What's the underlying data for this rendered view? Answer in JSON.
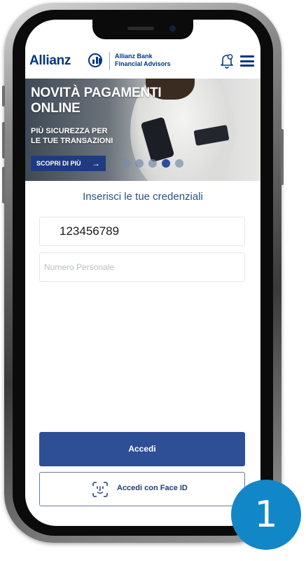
{
  "app": {
    "brand_name": "Allianz",
    "brand_subtitle_line1": "Allianz Bank",
    "brand_subtitle_line2": "Financial Advisors"
  },
  "banner": {
    "title_line1": "NOVITÀ PAGAMENTI",
    "title_line2": "ONLINE",
    "subtitle_line1": "PIÙ SICUREZZA PER",
    "subtitle_line2": "LE TUE TRANSAZIONI",
    "cta_label": "SCOPRI DI PIÙ",
    "cta_arrow": "→",
    "carousel_count": 5,
    "carousel_active_index": 3
  },
  "form": {
    "title": "Inserisci le tue credenziali",
    "username_value": "123456789",
    "personal_number_placeholder": "Numero Personale"
  },
  "actions": {
    "login_label": "Accedi",
    "face_id_label": "Accedi con Face ID"
  },
  "step": {
    "number": "1"
  },
  "colors": {
    "brand_blue": "#003781",
    "button_blue": "#2e4f96",
    "badge_blue": "#1287c8"
  }
}
